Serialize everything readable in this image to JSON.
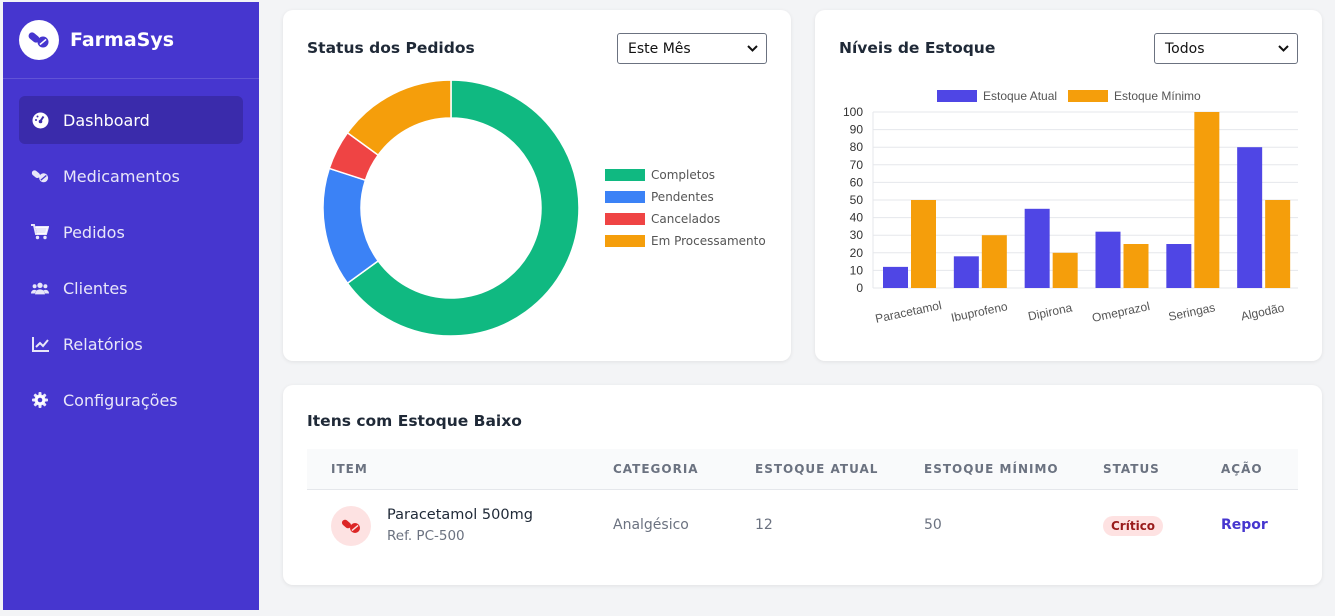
{
  "brand": {
    "name": "FarmaSys"
  },
  "sidebar": {
    "items": [
      {
        "label": "Dashboard",
        "icon": "dashboard-icon",
        "active": true
      },
      {
        "label": "Medicamentos",
        "icon": "pills-icon"
      },
      {
        "label": "Pedidos",
        "icon": "cart-icon"
      },
      {
        "label": "Clientes",
        "icon": "users-icon"
      },
      {
        "label": "Relatórios",
        "icon": "chart-line-icon"
      },
      {
        "label": "Configurações",
        "icon": "gear-icon"
      }
    ]
  },
  "orders_card": {
    "title": "Status dos Pedidos",
    "filter": "Este Mês"
  },
  "stock_card": {
    "title": "Níveis de Estoque",
    "filter": "Todos"
  },
  "low_stock": {
    "title": "Itens com Estoque Baixo",
    "columns": [
      "ITEM",
      "CATEGORIA",
      "ESTOQUE ATUAL",
      "ESTOQUE MÍNIMO",
      "STATUS",
      "AÇÃO"
    ],
    "rows": [
      {
        "name": "Paracetamol 500mg",
        "ref": "Ref. PC-500",
        "category": "Analgésico",
        "current": "12",
        "minimum": "50",
        "status": "Crítico",
        "action": "Repor"
      }
    ]
  },
  "colors": {
    "primary": "#4636cf",
    "completos": "#10b981",
    "pendentes": "#3b82f6",
    "cancelados": "#ef4444",
    "processamento": "#f59e0b"
  },
  "chart_data": [
    {
      "type": "pie",
      "variant": "doughnut",
      "categories": [
        "Completos",
        "Pendentes",
        "Cancelados",
        "Em Processamento"
      ],
      "values": [
        65,
        15,
        5,
        15
      ],
      "colors": [
        "#10b981",
        "#3b82f6",
        "#ef4444",
        "#f59e0b"
      ],
      "legend": "right"
    },
    {
      "type": "bar",
      "categories": [
        "Paracetamol",
        "Ibuprofeno",
        "Dipirona",
        "Omeprazol",
        "Seringas",
        "Algodão"
      ],
      "series": [
        {
          "name": "Estoque Atual",
          "values": [
            12,
            18,
            45,
            32,
            25,
            80
          ],
          "color": "#4f46e5"
        },
        {
          "name": "Estoque Mínimo",
          "values": [
            50,
            30,
            20,
            25,
            100,
            50
          ],
          "color": "#f59e0b"
        }
      ],
      "ylim": [
        0,
        100
      ],
      "yticks": [
        0,
        10,
        20,
        30,
        40,
        50,
        60,
        70,
        80,
        90,
        100
      ],
      "grid": true,
      "legend": "top"
    }
  ]
}
